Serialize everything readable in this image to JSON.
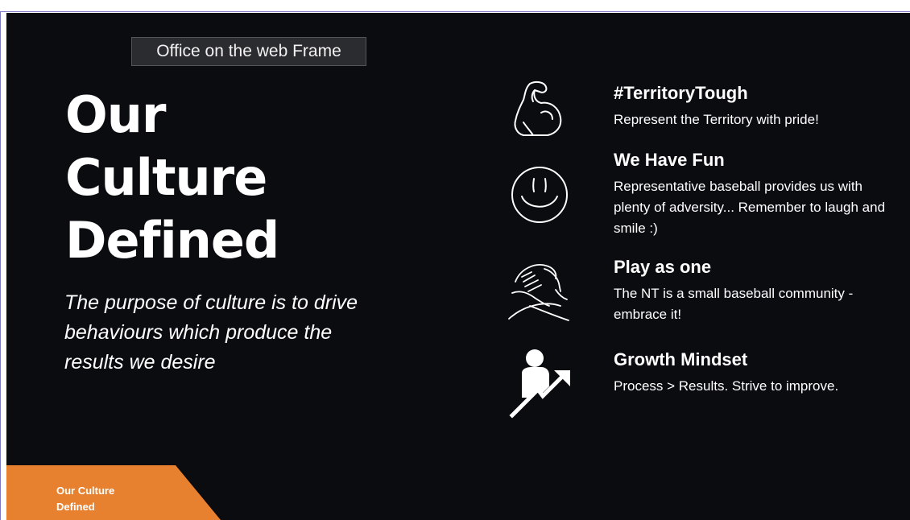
{
  "tooltip": {
    "text": "Office on the web Frame"
  },
  "slide": {
    "title_lines": [
      "Our",
      "Culture",
      "Defined"
    ],
    "subtitle": "The purpose of culture is to drive behaviours which produce the results we desire",
    "values": [
      {
        "heading": "#TerritoryTough",
        "text": "Represent the Territory with pride!",
        "icon": "flexed-bicep-icon"
      },
      {
        "heading": "We Have Fun",
        "text": "Representative baseball provides us with plenty of adversity... Remember to laugh and smile :)",
        "icon": "smiley-face-icon"
      },
      {
        "heading": "Play as one",
        "text": "The NT is a small baseball community - embrace it!",
        "icon": "handshake-icon"
      },
      {
        "heading": "Growth Mindset",
        "text": "Process > Results. Strive to improve.",
        "icon": "growth-person-icon"
      }
    ],
    "footer_badge": {
      "line1": "Our Culture",
      "line2": "Defined"
    }
  },
  "colors": {
    "slide_background": "#0a0c10",
    "accent_orange": "#e8812f",
    "text": "#ffffff"
  }
}
